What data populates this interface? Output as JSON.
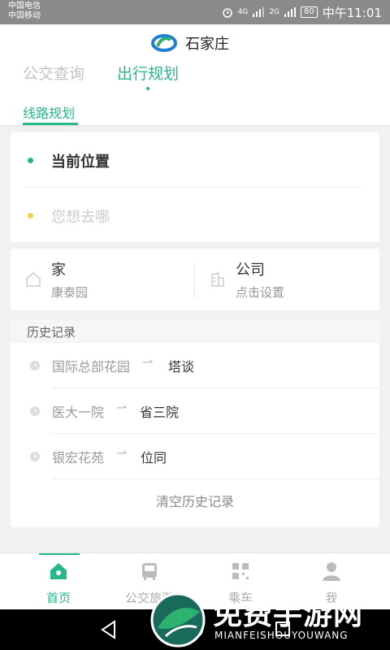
{
  "status_bar": {
    "carrier_1": "中国电信",
    "carrier_2": "中国移动",
    "network_1": "4G",
    "network_2": "2G",
    "battery": "80",
    "time": "中午11:01"
  },
  "header": {
    "city": "石家庄",
    "tabs": [
      {
        "label": "公交查询",
        "active": false
      },
      {
        "label": "出行规划",
        "active": true
      }
    ],
    "subtab": "线路规划"
  },
  "location": {
    "origin": "当前位置",
    "destination_placeholder": "您想去哪"
  },
  "favorites": [
    {
      "title": "家",
      "subtitle": "康泰园",
      "icon": "home-icon"
    },
    {
      "title": "公司",
      "subtitle": "点击设置",
      "icon": "building-icon"
    }
  ],
  "history": {
    "title": "历史记录",
    "items": [
      {
        "from": "国际总部花园",
        "to": "塔谈"
      },
      {
        "from": "医大一院",
        "to": "省三院"
      },
      {
        "from": "银宏花苑",
        "to": "位同"
      }
    ],
    "clear_label": "清空历史记录"
  },
  "bottom_nav": [
    {
      "label": "首页",
      "icon": "home-icon",
      "active": true
    },
    {
      "label": "公交旅游",
      "icon": "bus-icon",
      "active": false
    },
    {
      "label": "乘车",
      "icon": "qr-code-icon",
      "active": false
    },
    {
      "label": "我",
      "icon": "user-icon",
      "active": false
    }
  ],
  "watermark": {
    "text": "免费手游网",
    "subtext": "MIANFEISHOUYOUWANG"
  },
  "colors": {
    "accent": "#26b78a",
    "origin_dot": "#26b78a",
    "destination_dot": "#f3d34a"
  }
}
